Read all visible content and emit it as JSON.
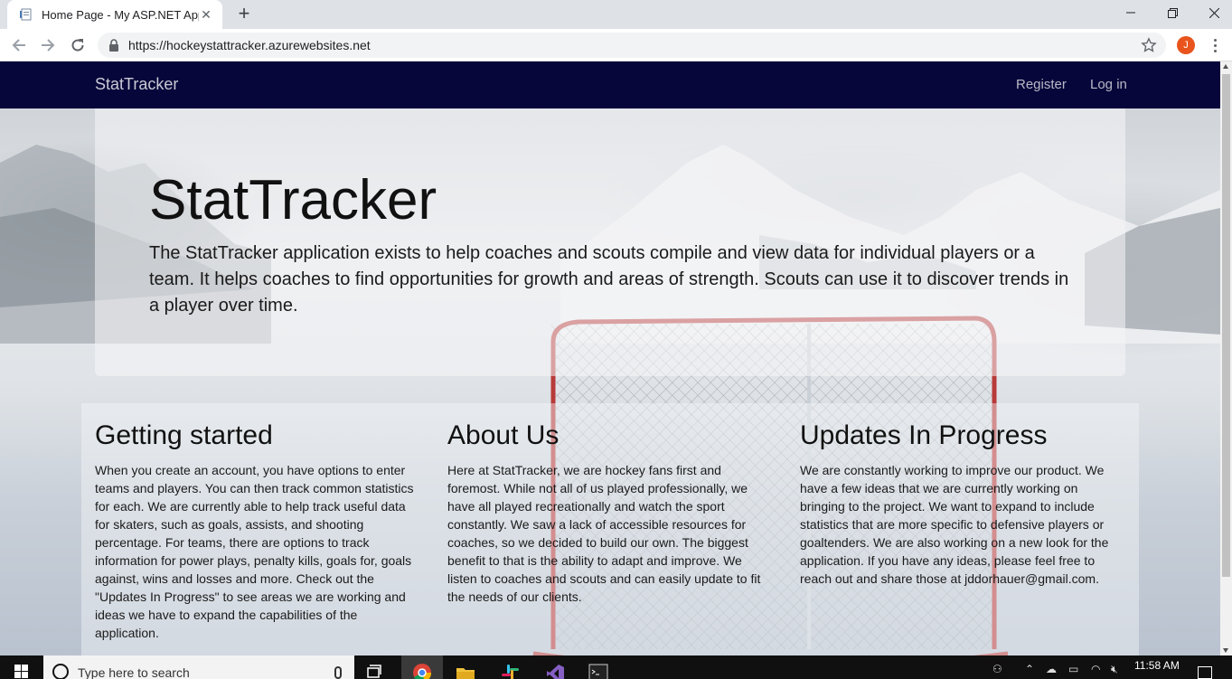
{
  "browser": {
    "tab_title": "Home Page - My ASP.NET Applic",
    "url": "https://hockeystattracker.azurewebsites.net",
    "profile_initial": "J",
    "icons": [
      "back-arrow-icon",
      "forward-arrow-icon",
      "reload-icon",
      "lock-icon",
      "star-icon",
      "more-icon"
    ]
  },
  "site": {
    "brand": "StatTracker",
    "nav": {
      "register": "Register",
      "login": "Log in"
    },
    "jumbotron": {
      "title": "StatTracker",
      "lead": "The StatTracker application exists to help coaches and scouts compile and view data for individual players or a team. It helps coaches to find opportunities for growth and areas of strength. Scouts can use it to discover trends in a player over time."
    },
    "columns": [
      {
        "heading": "Getting started",
        "body": "When you create an account, you have options to enter teams and players. You can then track common statistics for each. We are currently able to help track useful data for skaters, such as goals, assists, and shooting percentage. For teams, there are options to track information for power plays, penalty kills, goals for, goals against, wins and losses and more. Check out the \"Updates In Progress\" to see areas we are working and ideas we have to expand the capabilities of the application."
      },
      {
        "heading": "About Us",
        "body": "Here at StatTracker, we are hockey fans first and foremost. While not all of us played professionally, we have all played recreationally and watch the sport constantly. We saw a lack of accessible resources for coaches, so we decided to build our own. The biggest benefit to that is the ability to adapt and improve. We listen to coaches and scouts and can easily update to fit the needs of our clients."
      },
      {
        "heading": "Updates In Progress",
        "body": "We are constantly working to improve our product. We have a few ideas that we are currently working on bringing to the project. We want to expand to include statistics that are more specific to defensive players or goaltenders. We are also working on a new look for the application. If you have any ideas, please feel free to reach out and share those at jddorhauer@gmail.com."
      }
    ],
    "colors": {
      "navbar": "#06063a"
    }
  },
  "taskbar": {
    "search_placeholder": "Type here to search",
    "time": "11:58 AM"
  }
}
